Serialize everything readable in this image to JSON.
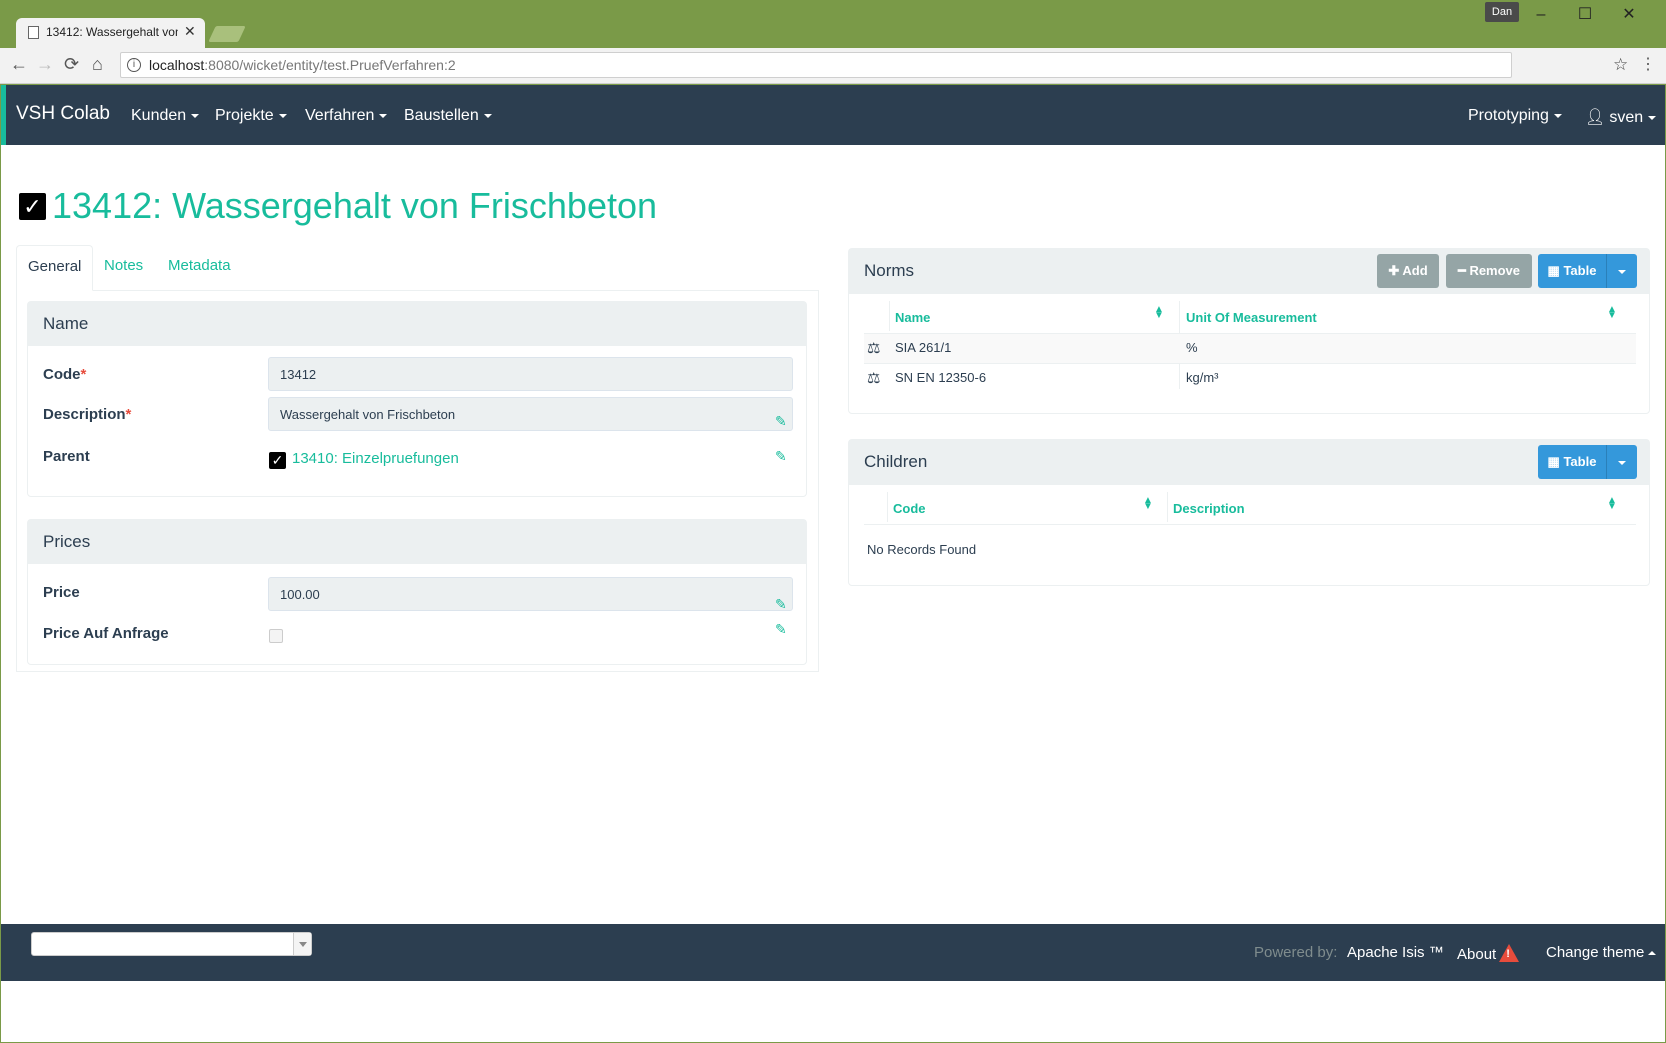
{
  "browser": {
    "tab_title": "13412: Wassergehalt von Frischbeton",
    "user_badge": "Dan",
    "url_host": "localhost",
    "url_path": ":8080/wicket/entity/test.PruefVerfahren:2"
  },
  "navbar": {
    "brand": "VSH Colab",
    "menus": [
      "Kunden",
      "Projekte",
      "Verfahren",
      "Baustellen"
    ],
    "right_menus": [
      "Prototyping",
      "sven"
    ]
  },
  "page": {
    "title": "13412: Wassergehalt von Frischbeton"
  },
  "tabs": [
    "General",
    "Notes",
    "Metadata"
  ],
  "name_panel": {
    "title": "Name",
    "code_label": "Code",
    "code_value": "13412",
    "description_label": "Description",
    "description_value": "Wassergehalt von Frischbeton",
    "parent_label": "Parent",
    "parent_link": "13410: Einzelpruefungen"
  },
  "prices_panel": {
    "title": "Prices",
    "price_label": "Price",
    "price_value": "100.00",
    "auf_anfrage_label": "Price Auf Anfrage"
  },
  "norms_panel": {
    "title": "Norms",
    "add_label": "Add",
    "remove_label": "Remove",
    "table_label": "Table",
    "columns": [
      "Name",
      "Unit Of Measurement"
    ],
    "rows": [
      {
        "name": "SIA 261/1",
        "unit": "%"
      },
      {
        "name": "SN EN 12350-6",
        "unit": "kg/m³"
      }
    ]
  },
  "children_panel": {
    "title": "Children",
    "table_label": "Table",
    "columns": [
      "Code",
      "Description"
    ],
    "empty_text": "No Records Found"
  },
  "footer": {
    "powered_by": "Powered by:",
    "apache_isis": "Apache Isis ™",
    "about": "About",
    "change_theme": "Change theme"
  },
  "colors": {
    "primary": "#2c3e50",
    "accent": "#18bc9c",
    "info": "#3498db",
    "danger": "#e74c3c",
    "chrome": "#7a9a48"
  }
}
